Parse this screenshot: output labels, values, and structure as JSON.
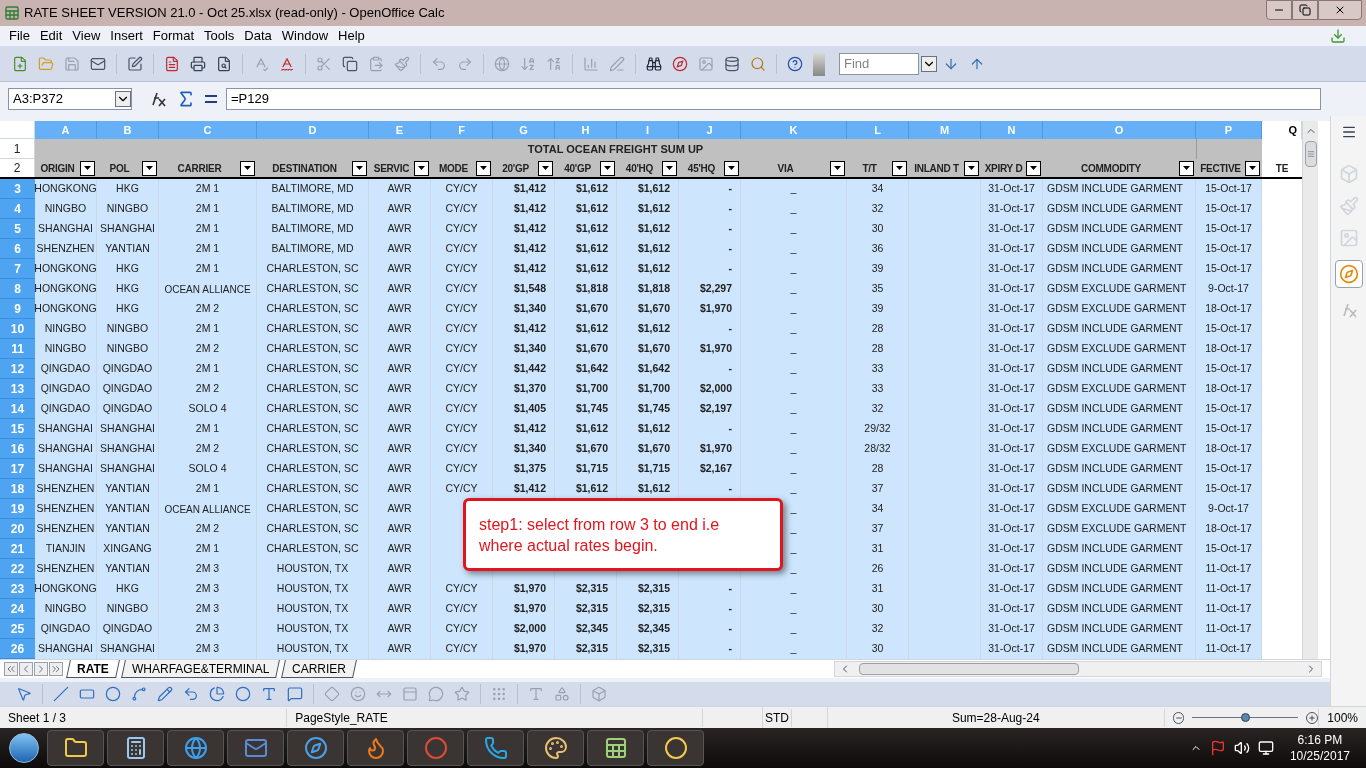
{
  "window": {
    "title": "RATE SHEET VERSION 21.0 - Oct 25.xlsx (read-only) - OpenOffice Calc"
  },
  "menu": [
    "File",
    "Edit",
    "View",
    "Insert",
    "Format",
    "Tools",
    "Data",
    "Window",
    "Help"
  ],
  "find": {
    "placeholder": "Find"
  },
  "formula_bar": {
    "name_box": "A3:P372",
    "formula": "=P129"
  },
  "columns": [
    {
      "letter": "A",
      "selected": true
    },
    {
      "letter": "B",
      "selected": true
    },
    {
      "letter": "C",
      "selected": true
    },
    {
      "letter": "D",
      "selected": true
    },
    {
      "letter": "E",
      "selected": true
    },
    {
      "letter": "F",
      "selected": true
    },
    {
      "letter": "G",
      "selected": true
    },
    {
      "letter": "H",
      "selected": true
    },
    {
      "letter": "I",
      "selected": true
    },
    {
      "letter": "J",
      "selected": true
    },
    {
      "letter": "K",
      "selected": true
    },
    {
      "letter": "L",
      "selected": true
    },
    {
      "letter": "M",
      "selected": true
    },
    {
      "letter": "N",
      "selected": true
    },
    {
      "letter": "O",
      "selected": true
    },
    {
      "letter": "P",
      "selected": true
    },
    {
      "letter": "Q",
      "selected": false
    }
  ],
  "title_row": {
    "num": "1",
    "text": "TOTAL OCEAN FREIGHT SUM UP"
  },
  "header_row": {
    "num": "2",
    "cells": [
      {
        "label": "ORIGIN",
        "filter": true
      },
      {
        "label": "POL",
        "filter": true
      },
      {
        "label": "CARRIER",
        "filter": true
      },
      {
        "label": "DESTINATION",
        "filter": true
      },
      {
        "label": "SERVIC",
        "filter": true
      },
      {
        "label": "MODE",
        "filter": true
      },
      {
        "label": "20'GP",
        "filter": true
      },
      {
        "label": "40'GP",
        "filter": true
      },
      {
        "label": "40'HQ",
        "filter": true
      },
      {
        "label": "45'HQ",
        "filter": true
      },
      {
        "label": "VIA",
        "filter": true
      },
      {
        "label": "T/T",
        "filter": true
      },
      {
        "label": "INLAND T",
        "filter": true
      },
      {
        "label": "XPIRY D",
        "filter": true
      },
      {
        "label": "COMMODITY",
        "filter": true
      },
      {
        "label": "FECTIVE",
        "filter": true
      },
      {
        "label": "TE",
        "filter": false
      }
    ]
  },
  "rows": [
    {
      "num": "3",
      "selected": true,
      "cells": [
        "HONGKONG",
        "HKG",
        "2M 1",
        "BALTIMORE, MD",
        "AWR",
        "CY/CY",
        "$1,412",
        "$1,612",
        "$1,612",
        "-",
        "_",
        "34",
        null,
        "31-Oct-17",
        "GDSM INCLUDE GARMENT",
        "15-Oct-17"
      ]
    },
    {
      "num": "4",
      "selected": true,
      "cells": [
        "NINGBO",
        "NINGBO",
        "2M 1",
        "BALTIMORE, MD",
        "AWR",
        "CY/CY",
        "$1,412",
        "$1,612",
        "$1,612",
        "-",
        "_",
        "32",
        null,
        "31-Oct-17",
        "GDSM INCLUDE GARMENT",
        "15-Oct-17"
      ]
    },
    {
      "num": "5",
      "selected": true,
      "cells": [
        "SHANGHAI",
        "SHANGHAI",
        "2M 1",
        "BALTIMORE, MD",
        "AWR",
        "CY/CY",
        "$1,412",
        "$1,612",
        "$1,612",
        "-",
        "_",
        "30",
        null,
        "31-Oct-17",
        "GDSM INCLUDE GARMENT",
        "15-Oct-17"
      ]
    },
    {
      "num": "6",
      "selected": true,
      "cells": [
        "SHENZHEN",
        "YANTIAN",
        "2M 1",
        "BALTIMORE, MD",
        "AWR",
        "CY/CY",
        "$1,412",
        "$1,612",
        "$1,612",
        "-",
        "_",
        "36",
        null,
        "31-Oct-17",
        "GDSM INCLUDE GARMENT",
        "15-Oct-17"
      ]
    },
    {
      "num": "7",
      "selected": true,
      "cells": [
        "HONGKONG",
        "HKG",
        "2M 1",
        "CHARLESTON, SC",
        "AWR",
        "CY/CY",
        "$1,412",
        "$1,612",
        "$1,612",
        "-",
        "_",
        "39",
        null,
        "31-Oct-17",
        "GDSM INCLUDE GARMENT",
        "15-Oct-17"
      ]
    },
    {
      "num": "8",
      "selected": true,
      "cells": [
        "HONGKONG",
        "HKG",
        "OCEAN ALLIANCE",
        "CHARLESTON, SC",
        "AWR",
        "CY/CY",
        "$1,548",
        "$1,818",
        "$1,818",
        "$2,297",
        "_",
        "35",
        null,
        "31-Oct-17",
        "GDSM EXCLUDE GARMENT",
        "9-Oct-17"
      ]
    },
    {
      "num": "9",
      "selected": true,
      "cells": [
        "HONGKONG",
        "HKG",
        "2M 2",
        "CHARLESTON, SC",
        "AWR",
        "CY/CY",
        "$1,340",
        "$1,670",
        "$1,670",
        "$1,970",
        "_",
        "39",
        null,
        "31-Oct-17",
        "GDSM EXCLUDE GARMENT",
        "18-Oct-17"
      ]
    },
    {
      "num": "10",
      "selected": true,
      "cells": [
        "NINGBO",
        "NINGBO",
        "2M 1",
        "CHARLESTON, SC",
        "AWR",
        "CY/CY",
        "$1,412",
        "$1,612",
        "$1,612",
        "-",
        "_",
        "28",
        null,
        "31-Oct-17",
        "GDSM INCLUDE GARMENT",
        "15-Oct-17"
      ]
    },
    {
      "num": "11",
      "selected": true,
      "cells": [
        "NINGBO",
        "NINGBO",
        "2M 2",
        "CHARLESTON, SC",
        "AWR",
        "CY/CY",
        "$1,340",
        "$1,670",
        "$1,670",
        "$1,970",
        "_",
        "28",
        null,
        "31-Oct-17",
        "GDSM EXCLUDE GARMENT",
        "18-Oct-17"
      ]
    },
    {
      "num": "12",
      "selected": true,
      "cells": [
        "QINGDAO",
        "QINGDAO",
        "2M 1",
        "CHARLESTON, SC",
        "AWR",
        "CY/CY",
        "$1,442",
        "$1,642",
        "$1,642",
        "-",
        "_",
        "33",
        null,
        "31-Oct-17",
        "GDSM INCLUDE GARMENT",
        "15-Oct-17"
      ]
    },
    {
      "num": "13",
      "selected": true,
      "cells": [
        "QINGDAO",
        "QINGDAO",
        "2M 2",
        "CHARLESTON, SC",
        "AWR",
        "CY/CY",
        "$1,370",
        "$1,700",
        "$1,700",
        "$2,000",
        "_",
        "33",
        null,
        "31-Oct-17",
        "GDSM EXCLUDE GARMENT",
        "18-Oct-17"
      ]
    },
    {
      "num": "14",
      "selected": true,
      "cells": [
        "QINGDAO",
        "QINGDAO",
        "SOLO 4",
        "CHARLESTON, SC",
        "AWR",
        "CY/CY",
        "$1,405",
        "$1,745",
        "$1,745",
        "$2,197",
        "_",
        "32",
        null,
        "31-Oct-17",
        "GDSM INCLUDE GARMENT",
        "15-Oct-17"
      ]
    },
    {
      "num": "15",
      "selected": true,
      "cells": [
        "SHANGHAI",
        "SHANGHAI",
        "2M 1",
        "CHARLESTON, SC",
        "AWR",
        "CY/CY",
        "$1,412",
        "$1,612",
        "$1,612",
        "-",
        "_",
        "29/32",
        null,
        "31-Oct-17",
        "GDSM INCLUDE GARMENT",
        "15-Oct-17"
      ]
    },
    {
      "num": "16",
      "selected": true,
      "cells": [
        "SHANGHAI",
        "SHANGHAI",
        "2M 2",
        "CHARLESTON, SC",
        "AWR",
        "CY/CY",
        "$1,340",
        "$1,670",
        "$1,670",
        "$1,970",
        "_",
        "28/32",
        null,
        "31-Oct-17",
        "GDSM EXCLUDE GARMENT",
        "18-Oct-17"
      ]
    },
    {
      "num": "17",
      "selected": true,
      "cells": [
        "SHANGHAI",
        "SHANGHAI",
        "SOLO 4",
        "CHARLESTON, SC",
        "AWR",
        "CY/CY",
        "$1,375",
        "$1,715",
        "$1,715",
        "$2,167",
        "_",
        "28",
        null,
        "31-Oct-17",
        "GDSM INCLUDE GARMENT",
        "15-Oct-17"
      ]
    },
    {
      "num": "18",
      "selected": true,
      "cells": [
        "SHENZHEN",
        "YANTIAN",
        "2M 1",
        "CHARLESTON, SC",
        "AWR",
        "CY/CY",
        "$1,412",
        "$1,612",
        "$1,612",
        "-",
        "_",
        "37",
        null,
        "31-Oct-17",
        "GDSM INCLUDE GARMENT",
        "15-Oct-17"
      ]
    },
    {
      "num": "19",
      "selected": true,
      "cells": [
        "SHENZHEN",
        "YANTIAN",
        "OCEAN ALLIANCE",
        "CHARLESTON, SC",
        "AWR",
        null,
        null,
        null,
        null,
        null,
        "_",
        "34",
        null,
        "31-Oct-17",
        "GDSM EXCLUDE GARMENT",
        "9-Oct-17"
      ]
    },
    {
      "num": "20",
      "selected": true,
      "cells": [
        "SHENZHEN",
        "YANTIAN",
        "2M 2",
        "CHARLESTON, SC",
        "AWR",
        null,
        null,
        null,
        null,
        null,
        "_",
        "37",
        null,
        "31-Oct-17",
        "GDSM EXCLUDE GARMENT",
        "18-Oct-17"
      ]
    },
    {
      "num": "21",
      "selected": true,
      "cells": [
        "TIANJIN",
        "XINGANG",
        "2M 1",
        "CHARLESTON, SC",
        "AWR",
        null,
        null,
        null,
        null,
        null,
        "_",
        "31",
        null,
        "31-Oct-17",
        "GDSM INCLUDE GARMENT",
        "15-Oct-17"
      ]
    },
    {
      "num": "22",
      "selected": true,
      "cells": [
        "SHENZHEN",
        "YANTIAN",
        "2M 3",
        "HOUSTON, TX",
        "AWR",
        null,
        null,
        null,
        null,
        null,
        "_",
        "26",
        null,
        "31-Oct-17",
        "GDSM INCLUDE GARMENT",
        "11-Oct-17"
      ]
    },
    {
      "num": "23",
      "selected": true,
      "cells": [
        "HONGKONG",
        "HKG",
        "2M 3",
        "HOUSTON, TX",
        "AWR",
        "CY/CY",
        "$1,970",
        "$2,315",
        "$2,315",
        "-",
        "_",
        "31",
        null,
        "31-Oct-17",
        "GDSM INCLUDE GARMENT",
        "11-Oct-17"
      ]
    },
    {
      "num": "24",
      "selected": true,
      "cells": [
        "NINGBO",
        "NINGBO",
        "2M 3",
        "HOUSTON, TX",
        "AWR",
        "CY/CY",
        "$1,970",
        "$2,315",
        "$2,315",
        "-",
        "_",
        "30",
        null,
        "31-Oct-17",
        "GDSM INCLUDE GARMENT",
        "11-Oct-17"
      ]
    },
    {
      "num": "25",
      "selected": true,
      "cells": [
        "QINGDAO",
        "QINGDAO",
        "2M 3",
        "HOUSTON, TX",
        "AWR",
        "CY/CY",
        "$2,000",
        "$2,345",
        "$2,345",
        "-",
        "_",
        "32",
        null,
        "31-Oct-17",
        "GDSM INCLUDE GARMENT",
        "11-Oct-17"
      ]
    },
    {
      "num": "26",
      "selected": true,
      "cells": [
        "SHANGHAI",
        "SHANGHAI",
        "2M 3",
        "HOUSTON, TX",
        "AWR",
        "CY/CY",
        "$1,970",
        "$2,315",
        "$2,315",
        "-",
        "_",
        "30",
        null,
        "31-Oct-17",
        "GDSM INCLUDE GARMENT",
        "11-Oct-17"
      ]
    }
  ],
  "callout": {
    "text": "step1: select from row 3 to end i.e where actual rates begin."
  },
  "sheet_tabs": [
    {
      "label": "RATE",
      "selected": true
    },
    {
      "label": "WHARFAGE&TERMINAL",
      "selected": false
    },
    {
      "label": "CARRIER",
      "selected": false
    }
  ],
  "status_bar": {
    "sheet": "Sheet 1 / 3",
    "page_style": "PageStyle_RATE",
    "mode": "STD",
    "sum": "Sum=28-Aug-24",
    "zoom": {
      "level": 0.5,
      "reading": "100%"
    }
  },
  "taskbar": {
    "time": "6:16 PM",
    "date": "10/25/2017"
  }
}
